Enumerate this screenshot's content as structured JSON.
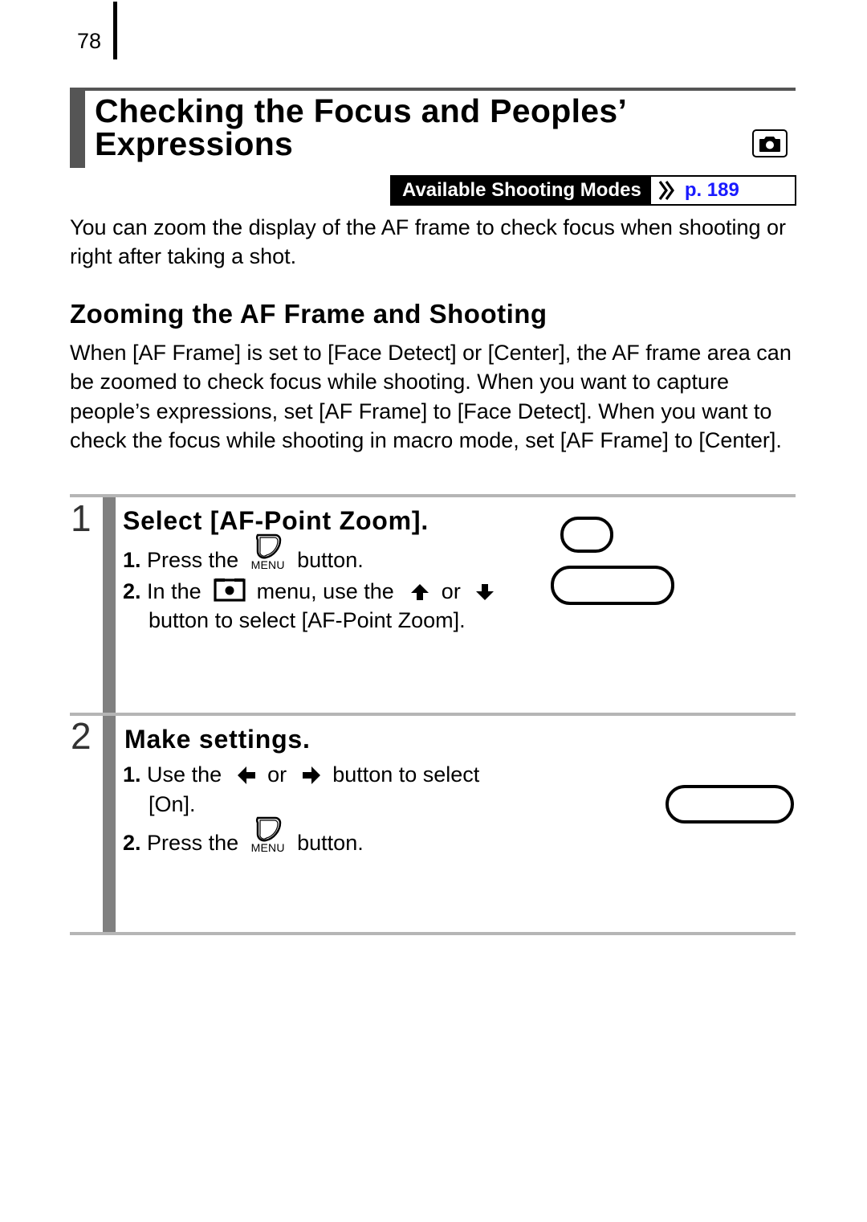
{
  "page": {
    "number": "78"
  },
  "header": {
    "title_line1": "Checking the Focus and Peoples’",
    "title_line2": "Expressions",
    "mode_icon": "camera-icon"
  },
  "available_modes": {
    "label": "Available Shooting Modes",
    "ref_icon": "double-chevron-right-icon",
    "ref_page": "p. 189",
    "link_color": "#1a1aff"
  },
  "intro": {
    "text": "You can zoom the display of the AF frame to check focus when shooting or right after taking a shot."
  },
  "section": {
    "heading": "Zooming the AF Frame and Shooting",
    "paragraph": "When [AF Frame] is set to [Face Detect] or [Center], the AF frame area can be zoomed to check focus while shooting. When you want to capture people’s expressions, set [AF Frame] to [Face Detect]. When you want to check the focus while shooting in macro mode, set [AF Frame] to [Center]."
  },
  "steps": [
    {
      "number": "1",
      "title": "Select [AF-Point Zoom].",
      "items": [
        {
          "num": "1.",
          "before": "Press the",
          "icon": "menu-button-icon",
          "icon_caption": "MENU",
          "after": "button."
        },
        {
          "num": "2.",
          "before": "In the",
          "icon": "shooting-menu-icon",
          "mid": "menu, use the",
          "icon2": "arrow-up-icon",
          "or": "or",
          "icon3": "arrow-down-icon",
          "line2": "button to select [AF-Point Zoom]."
        }
      ]
    },
    {
      "number": "2",
      "title": "Make settings.",
      "items": [
        {
          "num": "1.",
          "before": "Use the",
          "icon": "arrow-left-icon",
          "or": "or",
          "icon2": "arrow-right-icon",
          "after": "button to select",
          "line2": "[On]."
        },
        {
          "num": "2.",
          "before": "Press the",
          "icon": "menu-button-icon",
          "icon_caption": "MENU",
          "after": "button."
        }
      ]
    }
  ]
}
